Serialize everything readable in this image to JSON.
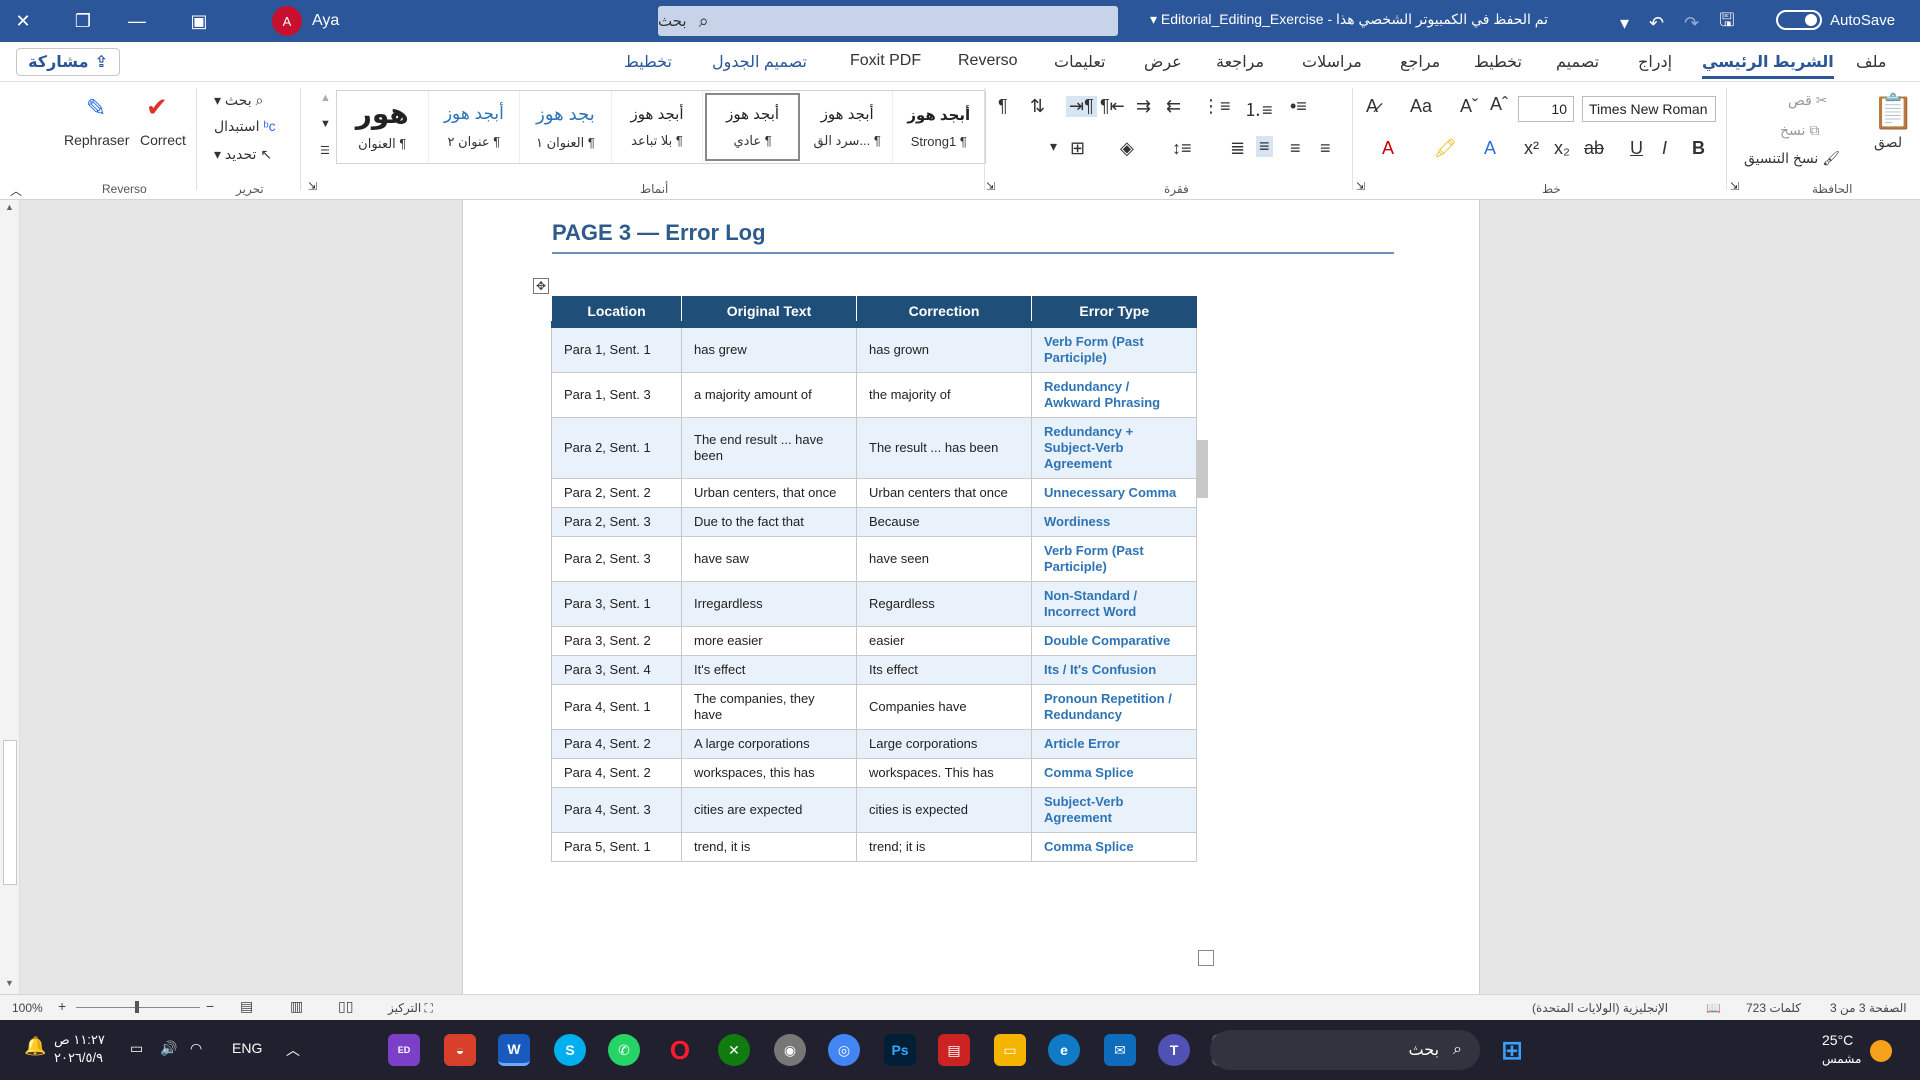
{
  "titlebar": {
    "user_initial": "A",
    "user_name": "Aya",
    "search_placeholder": "بحث",
    "doc_title": "Editorial_Editing_Exercise  -  تم الحفظ في الكمبيوتر الشخصي هذا",
    "autosave_label": "AutoSave"
  },
  "tabs": {
    "share": "مشاركة",
    "items": [
      "ملف",
      "الشريط الرئيسي",
      "إدراج",
      "تصميم",
      "تخطيط",
      "مراجع",
      "مراسلات",
      "مراجعة",
      "عرض",
      "تعليمات",
      "Reverso",
      "Foxit PDF",
      "تصميم الجدول",
      "تخطيط"
    ]
  },
  "ribbon": {
    "groups": {
      "reverso": "Reverso",
      "editing": "تحرير",
      "styles": "أنماط",
      "paragraph": "فقرة",
      "font": "خط",
      "clipboard": "الحافظة"
    },
    "reverso_buttons": {
      "rephraser": "Rephraser",
      "correct": "Correct"
    },
    "editing_buttons": {
      "find": "بحث",
      "replace": "استبدال",
      "select": "تحديد"
    },
    "styles": [
      {
        "preview": "هور",
        "name": "العنوان ¶"
      },
      {
        "preview": "أبجد هوز",
        "name": "عنوان ٢ ¶"
      },
      {
        "preview": "بجد هوز",
        "name": "العنوان ١ ¶"
      },
      {
        "preview": "أبجد هوز",
        "name": "بلا تباعد ¶"
      },
      {
        "preview": "أبجد هوز",
        "name": "عادي ¶"
      },
      {
        "preview": "أبجد هوز",
        "name": "سرد الق... ¶"
      },
      {
        "preview": "أبجد هوز",
        "name": "Strong1 ¶"
      }
    ],
    "font_name": "Times New Roman",
    "font_size": "10",
    "clipboard_buttons": {
      "paste": "لصق",
      "cut": "قص",
      "copy": "نسخ",
      "format_painter": "نسخ التنسيق"
    }
  },
  "document": {
    "page_title": "PAGE 3 — Error Log",
    "table": {
      "headers": [
        "Location",
        "Original Text",
        "Correction",
        "Error Type"
      ],
      "rows": [
        [
          "Para 1, Sent. 1",
          "has grew",
          "has grown",
          "Verb Form (Past Participle)"
        ],
        [
          "Para 1, Sent. 3",
          "a majority amount of",
          "the majority of",
          "Redundancy / Awkward Phrasing"
        ],
        [
          "Para 2, Sent. 1",
          "The end result ... have been",
          "The result ... has been",
          "Redundancy + Subject-Verb Agreement"
        ],
        [
          "Para 2, Sent. 2",
          "Urban centers, that once",
          "Urban centers that once",
          "Unnecessary Comma"
        ],
        [
          "Para 2, Sent. 3",
          "Due to the fact that",
          "Because",
          "Wordiness"
        ],
        [
          "Para 2, Sent. 3",
          "have saw",
          "have seen",
          "Verb Form (Past Participle)"
        ],
        [
          "Para 3, Sent. 1",
          "Irregardless",
          "Regardless",
          "Non-Standard / Incorrect Word"
        ],
        [
          "Para 3, Sent. 2",
          "more easier",
          "easier",
          "Double Comparative"
        ],
        [
          "Para 3, Sent. 4",
          "It's effect",
          "Its effect",
          "Its / It's Confusion"
        ],
        [
          "Para 4, Sent. 1",
          "The companies, they have",
          "Companies have",
          "Pronoun Repetition / Redundancy"
        ],
        [
          "Para 4, Sent. 2",
          "A large corporations",
          "Large corporations",
          "Article Error"
        ],
        [
          "Para 4, Sent. 2",
          "workspaces, this has",
          "workspaces. This has",
          "Comma Splice"
        ],
        [
          "Para 4, Sent. 3",
          "cities are expected",
          "cities is expected",
          "Subject-Verb Agreement"
        ],
        [
          "Para 5, Sent. 1",
          "trend, it is",
          "trend; it is",
          "Comma Splice"
        ]
      ]
    }
  },
  "statusbar": {
    "page": "الصفحة 3 من 3",
    "words": "723 كلمات",
    "language": "الإنجليزية (الولايات المتحدة)",
    "focus": "التركيز",
    "zoom": "100%"
  },
  "taskbar": {
    "search": "بحث",
    "weather_temp": "25°C",
    "weather_desc": "مشمس",
    "lang": "ENG",
    "time": "١١:٢٧ ص",
    "date": "٢٠٢٦/٥/٩"
  }
}
